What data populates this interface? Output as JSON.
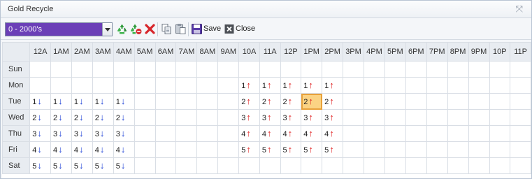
{
  "window": {
    "title": "Gold Recycle",
    "close_glyph": "⤧"
  },
  "toolbar": {
    "filter_value": "0 - 2000's",
    "icons": [
      "recycle-icon",
      "recycle-remove-icon",
      "delete-icon",
      "copy-icon",
      "paste-icon",
      "save-icon",
      "close-icon"
    ],
    "save_label": "Save",
    "close_label": "Close"
  },
  "colors": {
    "combo_bg": "#6b3fb7",
    "up_arrow": "#e02020",
    "down_arrow": "#1c3fd6",
    "selected_cell": "#fbd384"
  },
  "grid": {
    "hours": [
      "12A",
      "1AM",
      "2AM",
      "3AM",
      "4AM",
      "5AM",
      "6AM",
      "7AM",
      "8AM",
      "9AM",
      "10A",
      "11A",
      "12P",
      "1PM",
      "2PM",
      "3PM",
      "4PM",
      "5PM",
      "6PM",
      "7PM",
      "8PM",
      "9PM",
      "10P",
      "11P"
    ],
    "days": [
      "Sun",
      "Mon",
      "Tue",
      "Wed",
      "Thu",
      "Fri",
      "Sat"
    ],
    "cells": [
      [
        "",
        "",
        "",
        "",
        "",
        "",
        "",
        "",
        "",
        "",
        "",
        "",
        "",
        "",
        "",
        "",
        "",
        "",
        "",
        "",
        "",
        "",
        "",
        ""
      ],
      [
        "",
        "",
        "",
        "",
        "",
        "",
        "",
        "",
        "",
        "",
        "1up",
        "1up",
        "1up",
        "1up",
        "1up",
        "",
        "",
        "",
        "",
        "",
        "",
        "",
        "",
        ""
      ],
      [
        "1down",
        "1down",
        "1down",
        "1down",
        "1down",
        "",
        "",
        "",
        "",
        "",
        "2up",
        "2up",
        "2up",
        "2up",
        "2up",
        "",
        "",
        "",
        "",
        "",
        "",
        "",
        "",
        ""
      ],
      [
        "2down",
        "2down",
        "2down",
        "2down",
        "2down",
        "",
        "",
        "",
        "",
        "",
        "3up",
        "3up",
        "3up",
        "3up",
        "3up",
        "",
        "",
        "",
        "",
        "",
        "",
        "",
        "",
        ""
      ],
      [
        "3down",
        "3down",
        "3down",
        "3down",
        "3down",
        "",
        "",
        "",
        "",
        "",
        "4up",
        "4up",
        "4up",
        "4up",
        "4up",
        "",
        "",
        "",
        "",
        "",
        "",
        "",
        "",
        ""
      ],
      [
        "4down",
        "4down",
        "4down",
        "4down",
        "4down",
        "",
        "",
        "",
        "",
        "",
        "5up",
        "5up",
        "5up",
        "5up",
        "5up",
        "",
        "",
        "",
        "",
        "",
        "",
        "",
        "",
        ""
      ],
      [
        "5down",
        "5down",
        "5down",
        "5down",
        "5down",
        "",
        "",
        "",
        "",
        "",
        "",
        "",
        "",
        "",
        "",
        "",
        "",
        "",
        "",
        "",
        "",
        "",
        "",
        ""
      ]
    ],
    "selected": {
      "day": "Tue",
      "hour": "1PM"
    }
  }
}
